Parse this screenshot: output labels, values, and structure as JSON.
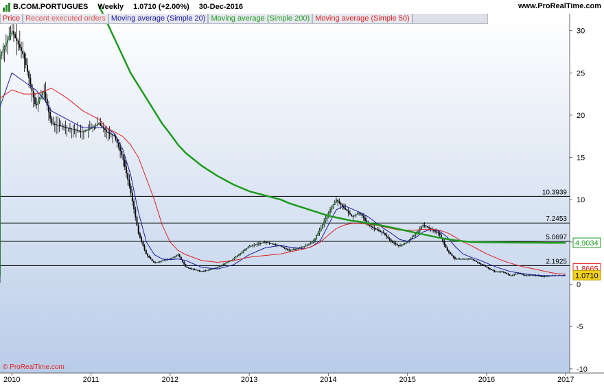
{
  "header": {
    "symbol": "B.COM.PORTUGUES",
    "timeframe": "Weekly",
    "last_change": "1.0710 (+2.00%)",
    "date": "30-Dec-2016",
    "site": "www.ProRealTime.com"
  },
  "legend": [
    {
      "label": "Price",
      "color": "#e02020"
    },
    {
      "label": "Recent executed orders",
      "color": "#e05a5a"
    },
    {
      "label": "Moving average (Simple 20)",
      "color": "#1a1aa0"
    },
    {
      "label": "Moving average (Simple 200)",
      "color": "#1d9a1d"
    },
    {
      "label": "Moving average (Simple 50)",
      "color": "#e02020"
    }
  ],
  "copyright": "© ProRealTime.com",
  "colors": {
    "background_top": "#ffffff",
    "background_bottom": "#b9cce8",
    "candle": "#000000",
    "ma20": "#1a1aa0",
    "ma50": "#e02020",
    "ma200": "#1d9a1d",
    "bands": "#a0a8b8",
    "level_lines": "#000000",
    "last_price_badge": "#f2d21c"
  },
  "chart_data": {
    "type": "line",
    "x": [
      2009.85,
      2010.0,
      2010.15,
      2010.3,
      2010.4,
      2010.5,
      2010.7,
      2010.9,
      2011.1,
      2011.2,
      2011.3,
      2011.4,
      2011.5,
      2011.6,
      2011.7,
      2011.8,
      2011.9,
      2012.0,
      2012.1,
      2012.2,
      2012.4,
      2012.6,
      2012.8,
      2013.0,
      2013.2,
      2013.4,
      2013.5,
      2013.6,
      2013.7,
      2013.8,
      2013.9,
      2014.0,
      2014.1,
      2014.2,
      2014.3,
      2014.4,
      2014.5,
      2014.6,
      2014.7,
      2014.8,
      2014.9,
      2015.0,
      2015.1,
      2015.2,
      2015.3,
      2015.4,
      2015.5,
      2015.6,
      2015.7,
      2015.8,
      2015.9,
      2016.0,
      2016.1,
      2016.2,
      2016.3,
      2016.4,
      2016.5,
      2016.6,
      2016.7,
      2016.8,
      2016.9,
      2017.0
    ],
    "series": [
      {
        "name": "Price",
        "values": [
          27,
          30,
          27,
          21,
          23,
          19,
          18.5,
          18,
          19,
          18,
          17.5,
          15,
          11,
          6,
          3.5,
          2.5,
          2.8,
          3,
          3.5,
          2,
          1.5,
          2,
          3,
          4.5,
          5,
          4.5,
          4,
          4.2,
          4.5,
          5,
          6.5,
          8.5,
          10,
          9,
          8,
          8.5,
          7,
          6.5,
          6,
          5,
          4.5,
          5,
          6,
          7,
          6.5,
          6,
          4,
          3,
          3,
          3,
          2.5,
          2,
          1.5,
          1.5,
          1,
          1.3,
          1.0,
          1.1,
          0.9,
          1.0,
          1.05,
          1.071
        ]
      },
      {
        "name": "Moving average (Simple 20)",
        "values": [
          21,
          25,
          24,
          23,
          22,
          20.5,
          19.5,
          18.5,
          18.5,
          18.5,
          17.8,
          16,
          13,
          8.5,
          5,
          3.5,
          3,
          2.9,
          3,
          2.8,
          2,
          1.8,
          2.3,
          3.5,
          4.3,
          4.6,
          4.4,
          4.3,
          4.2,
          4.5,
          5.2,
          7,
          8.8,
          9.3,
          8.9,
          8.5,
          8,
          7.3,
          6.6,
          6,
          5.3,
          5.1,
          5.5,
          6.2,
          6.5,
          6.3,
          5.6,
          4.5,
          3.6,
          3.2,
          2.9,
          2.5,
          2.1,
          1.8,
          1.5,
          1.35,
          1.2,
          1.1,
          1.05,
          1.02,
          1.02,
          1.03
        ]
      },
      {
        "name": "Moving average (Simple 50)",
        "values": [
          22,
          23,
          22.5,
          22.5,
          22.8,
          23.2,
          22,
          20.5,
          19.5,
          18.5,
          18,
          17.5,
          16.5,
          15,
          12.5,
          10,
          7,
          5,
          4,
          3.5,
          2.8,
          2.6,
          2.8,
          3.2,
          3.4,
          3.6,
          3.8,
          4,
          4.2,
          4.5,
          5,
          5.8,
          6.6,
          7,
          7.2,
          7.2,
          7.1,
          7,
          6.8,
          6.6,
          6.4,
          6.4,
          6.4,
          6.5,
          6.5,
          6.4,
          6.1,
          5.6,
          5,
          4.6,
          4.1,
          3.6,
          3.2,
          2.8,
          2.5,
          2.2,
          2,
          1.8,
          1.6,
          1.4,
          1.25,
          1.2
        ]
      },
      {
        "name": "Moving average (Simple 200)",
        "values": [
          null,
          null,
          null,
          null,
          null,
          null,
          null,
          null,
          33,
          31,
          29,
          27,
          25,
          23.5,
          22,
          20.5,
          19,
          17.8,
          16.5,
          15.5,
          14,
          12.8,
          11.8,
          11,
          10.5,
          10,
          9.6,
          9.3,
          9,
          8.7,
          8.4,
          8.1,
          7.9,
          7.7,
          7.5,
          7.4,
          7.2,
          7.1,
          6.9,
          6.7,
          6.5,
          6.3,
          6.1,
          5.9,
          5.7,
          5.5,
          5.35,
          5.2,
          5.1,
          5,
          4.98,
          4.97,
          4.96,
          4.95,
          4.94,
          4.93,
          4.92,
          4.915,
          4.91,
          4.906,
          4.903,
          4.9034
        ]
      }
    ],
    "horizontal_levels": [
      "10.3939",
      "7.2453",
      "5.0697",
      "2.1925"
    ],
    "price_badges": [
      "4.9034",
      "1.8665",
      "1.0710"
    ],
    "x_ticks": [
      "2010",
      "2011",
      "2012",
      "2013",
      "2014",
      "2015",
      "2016",
      "2017"
    ],
    "y_ticks": [
      "30",
      "25",
      "20",
      "15",
      "10",
      "5",
      "0",
      "-5",
      "-10"
    ],
    "xlim": [
      2009.85,
      2017.05
    ],
    "ylim": [
      -10.5,
      32
    ],
    "xlabel": "",
    "ylabel": "",
    "grid": false,
    "legend_position": "top-left"
  }
}
